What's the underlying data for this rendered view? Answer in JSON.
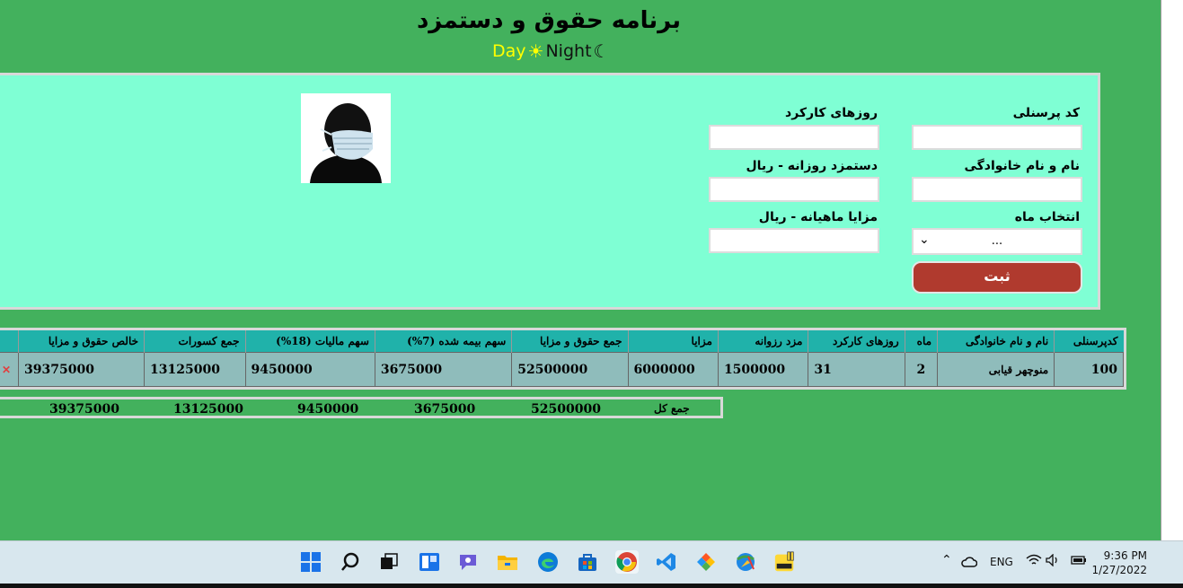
{
  "header": {
    "title": "برنامه حقوق و دستمزد",
    "day_label": "Day",
    "night_label": "Night",
    "sun_icon": "☀",
    "moon_icon": "☾"
  },
  "form": {
    "personnel_code_label": "کد پرسنلی",
    "fullname_label": "نام و نام خانوادگی",
    "month_label": "انتخاب ماه",
    "workdays_label": "روزهای کارکرد",
    "daily_wage_label": "دستمزد روزانه - ریال",
    "monthly_benefits_label": "مزایا ماهیانه - ریال",
    "month_select_value": "...",
    "submit_label": "ثبت"
  },
  "table": {
    "headers": [
      "کدپرسنلی",
      "نام و نام خانوادگی",
      "ماه",
      "روزهای کارکرد",
      "مزد رزوانه",
      "مزایا",
      "جمع حقوق و مزایا",
      "سهم بیمه شده (7%)",
      "سهم مالیات (18%)",
      "جمع کسورات",
      "خالص حقوق و مزایا"
    ],
    "rows": [
      [
        "100",
        "منوچهر قیابی",
        "2",
        "31",
        "1500000",
        "6000000",
        "52500000",
        "3675000",
        "9450000",
        "13125000",
        "39375000"
      ]
    ]
  },
  "totals": {
    "label": "جمع کل",
    "gross": "52500000",
    "insurance": "3675000",
    "tax": "9450000",
    "deductions": "13125000",
    "net": "39375000"
  },
  "taskbar": {
    "lang": "ENG",
    "time": "9:36 PM",
    "date": "1/27/2022",
    "icons": [
      "windows-start-icon",
      "search-icon",
      "task-view-icon",
      "widgets-icon",
      "chat-icon",
      "file-explorer-icon",
      "edge-icon",
      "store-icon",
      "chrome-icon",
      "vscode-icon",
      "git-icon",
      "ie-download-icon",
      "kmplayer-icon"
    ]
  },
  "colors": {
    "app_bg": "#43b15d",
    "panel_bg": "#7fffd4",
    "button_bg": "#b03a2e",
    "table_header": "#20b2aa",
    "table_cell": "#8fbcbb",
    "day_color": "#ffff00"
  }
}
